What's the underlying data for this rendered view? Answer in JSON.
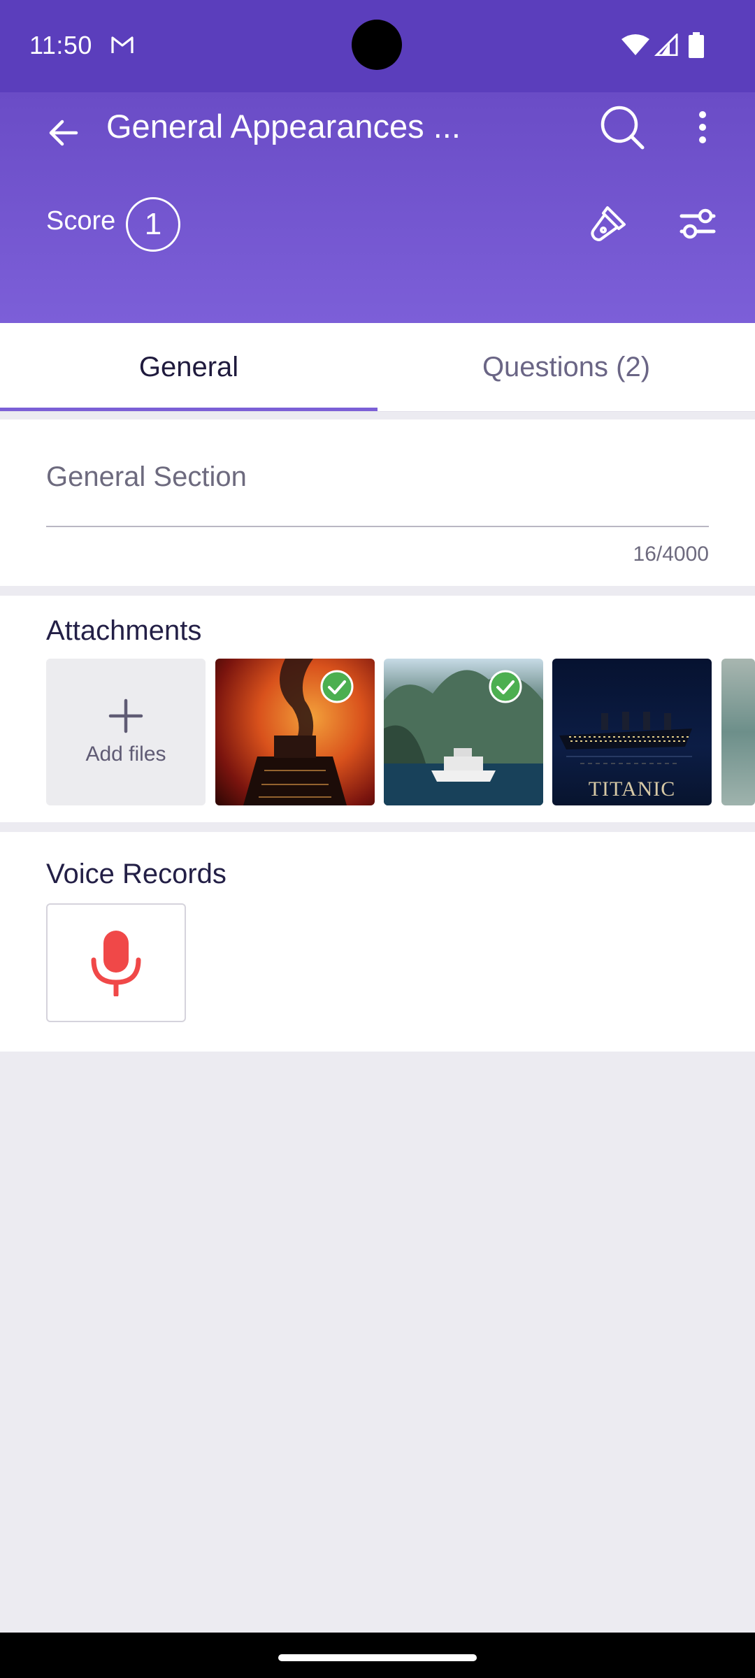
{
  "status_bar": {
    "time": "11:50",
    "icons": [
      "gmail-icon",
      "wifi-icon",
      "signal-icon",
      "battery-icon"
    ]
  },
  "toolbar": {
    "title": "General Appearances ...",
    "back_icon": "arrow-left-icon",
    "search_icon": "search-icon",
    "more_icon": "more-vertical-icon"
  },
  "score": {
    "label": "Score",
    "value": "1"
  },
  "actions": {
    "flashlight_icon": "flashlight-icon",
    "filter_icon": "sliders-icon"
  },
  "tabs": [
    {
      "label": "General",
      "selected": true
    },
    {
      "label": "Questions (2)",
      "selected": false
    }
  ],
  "general_section": {
    "placeholder": "General Section",
    "counter": "16/4000"
  },
  "attachments": {
    "title": "Attachments",
    "add_label": "Add files",
    "items": [
      {
        "name": "attachment-ship-fire",
        "checked": true
      },
      {
        "name": "attachment-cruise-fjord",
        "checked": true
      },
      {
        "name": "attachment-titanic",
        "checked": false,
        "caption": "TITANIC"
      },
      {
        "name": "attachment-partial",
        "checked": false
      }
    ]
  },
  "voice_records": {
    "title": "Voice Records",
    "mic_icon": "microphone-icon"
  },
  "colors": {
    "header": "#6a4cc6",
    "accent": "#7b5fd6",
    "mic": "#f04848",
    "check": "#4caf50"
  }
}
